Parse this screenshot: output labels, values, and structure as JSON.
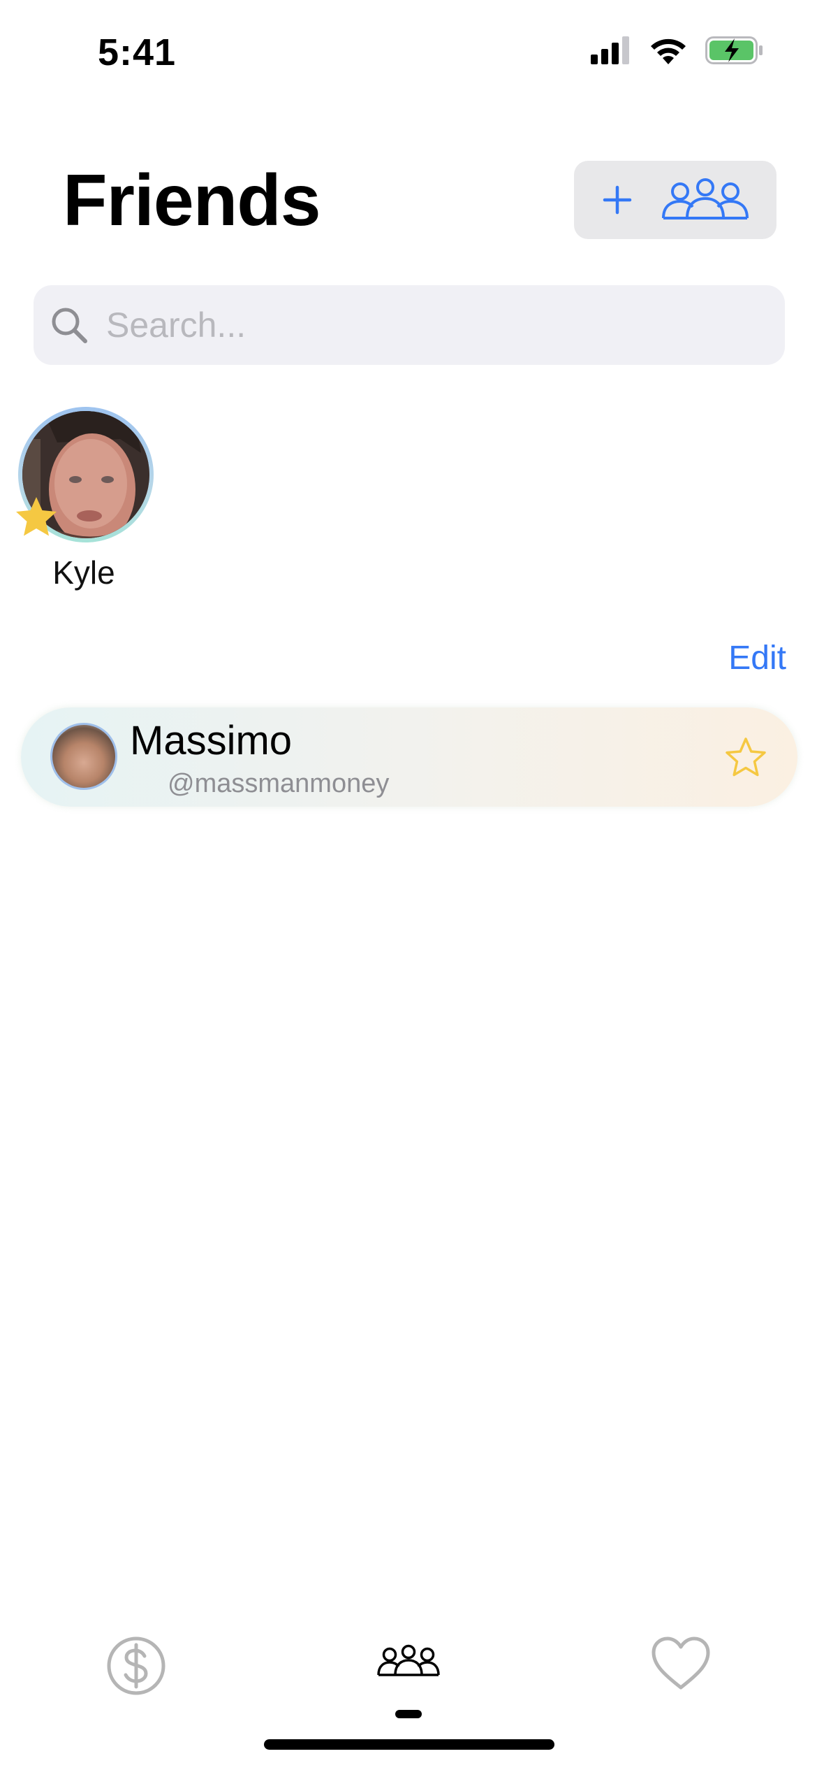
{
  "status_bar": {
    "time": "5:41",
    "icons": [
      "cellular-signal-icon",
      "wifi-icon",
      "battery-charging-icon"
    ],
    "battery_color": "#5ac467"
  },
  "header": {
    "title": "Friends",
    "add_group_button": {
      "icons": [
        "plus-icon",
        "people-group-icon"
      ]
    }
  },
  "search": {
    "placeholder": "Search...",
    "value": ""
  },
  "favorites": [
    {
      "name": "Kyle",
      "badge": "star-filled-icon"
    }
  ],
  "edit_label": "Edit",
  "friends": [
    {
      "name": "Massimo",
      "handle": "@massmanmoney",
      "favorite_icon": "star-outline-icon"
    }
  ],
  "tab_bar": {
    "tabs": [
      {
        "icon": "dollar-circle-icon",
        "selected": false
      },
      {
        "icon": "people-group-icon",
        "selected": true
      },
      {
        "icon": "heart-icon",
        "selected": false
      }
    ]
  },
  "colors": {
    "accent": "#3478f6",
    "star": "#f5c842",
    "search_bg": "#f0f0f5",
    "button_bg": "#e8e8ea"
  }
}
